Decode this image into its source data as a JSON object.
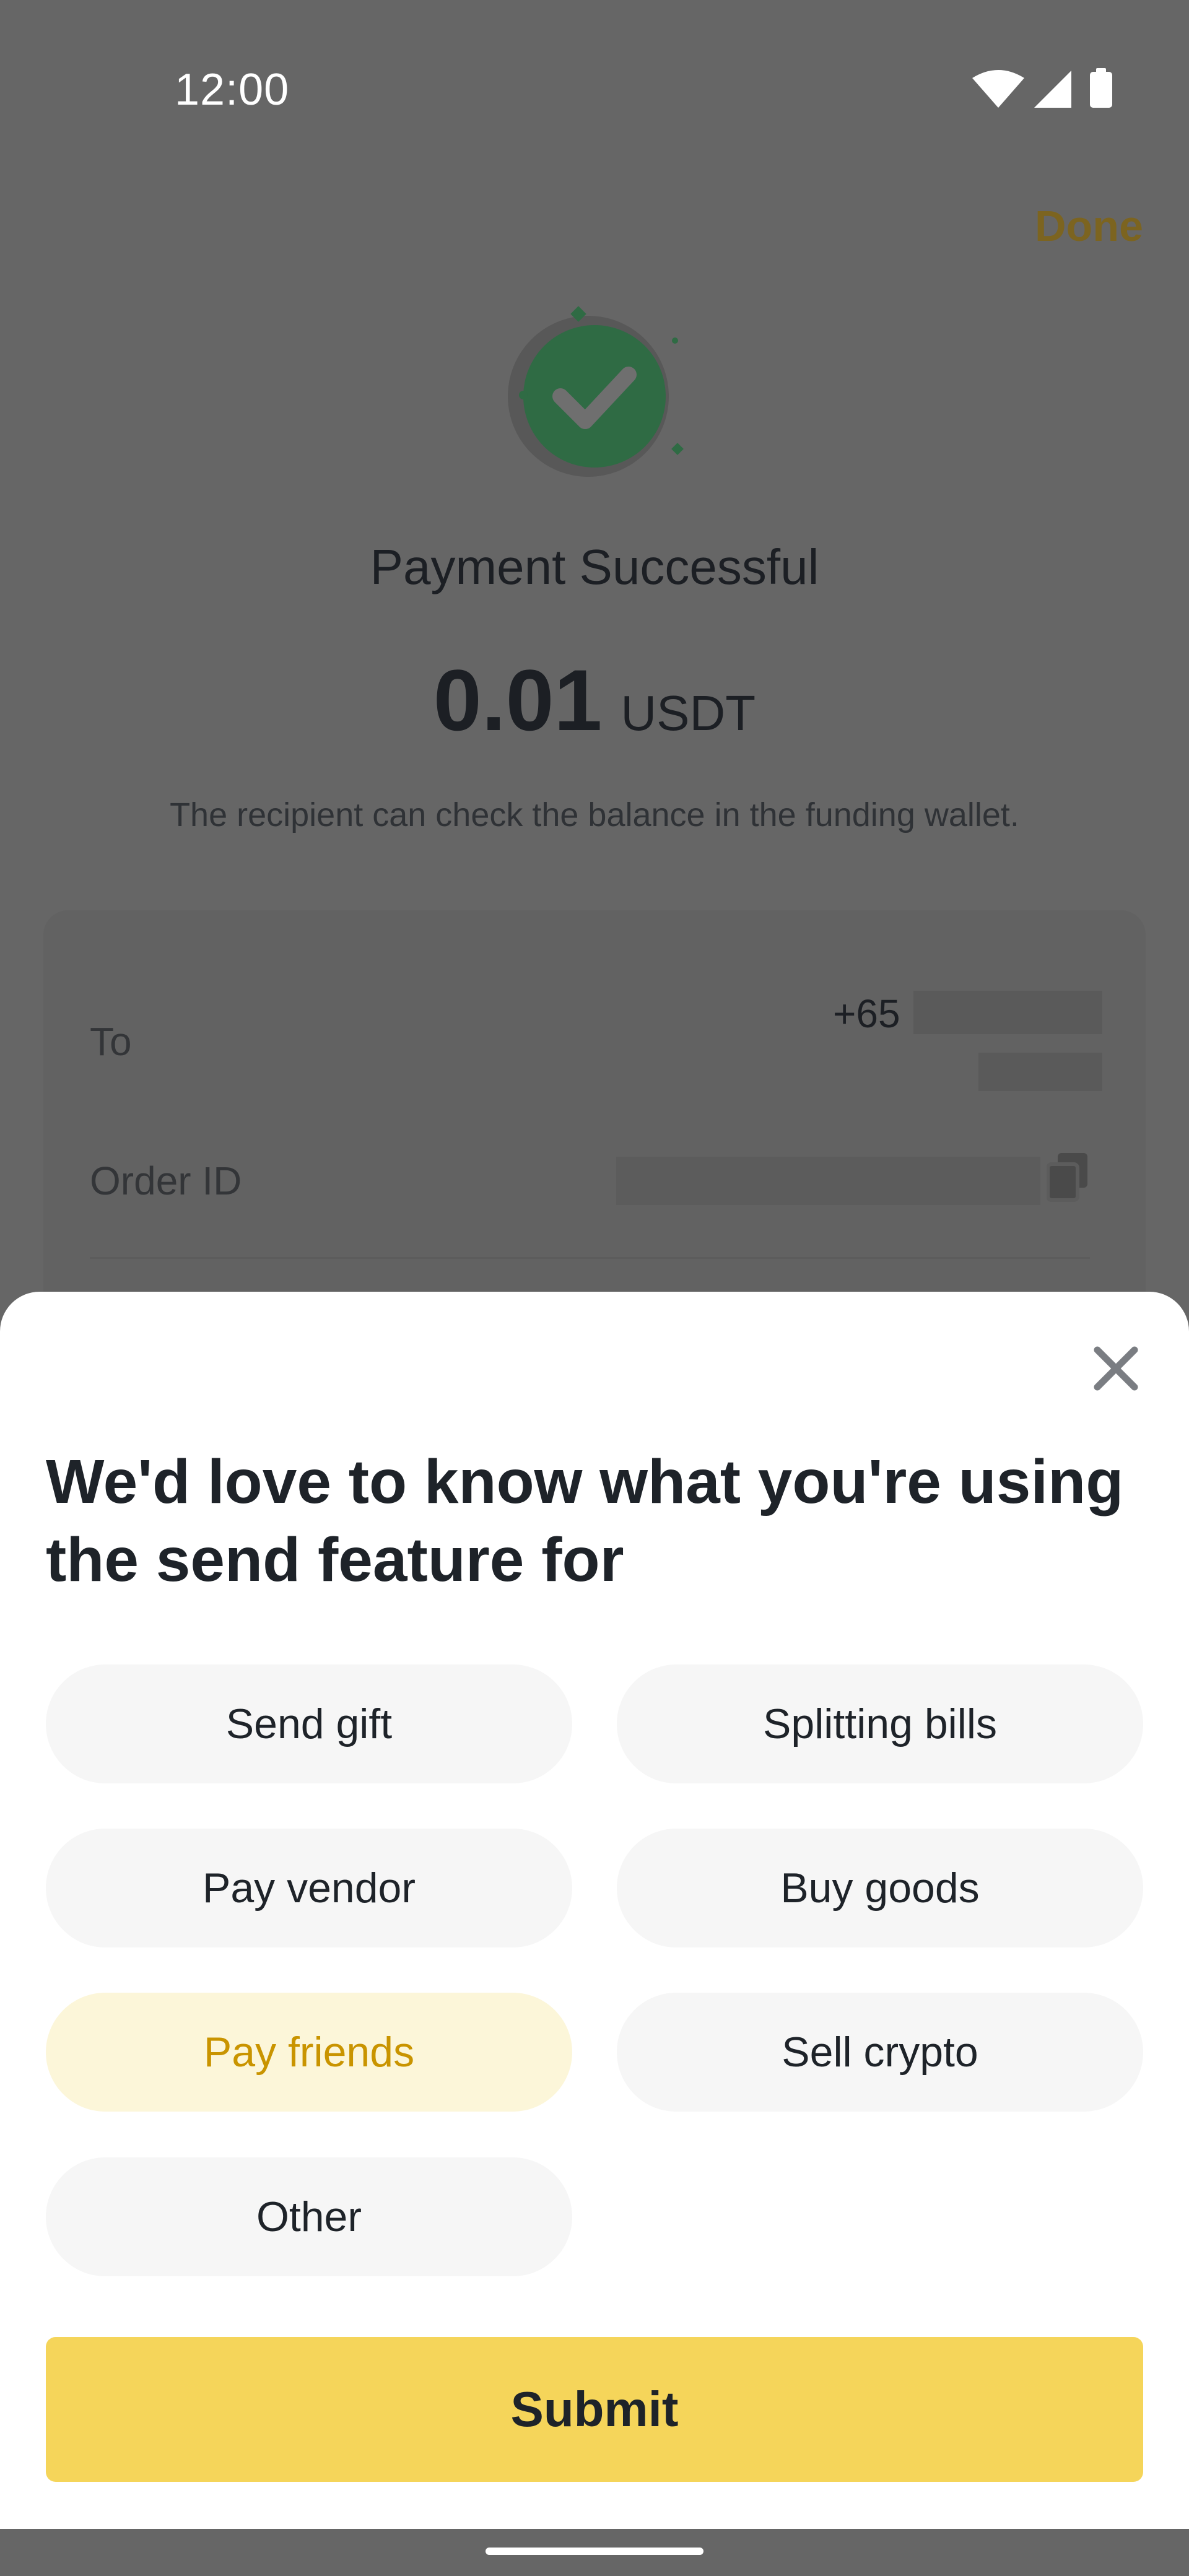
{
  "status_bar": {
    "time": "12:00",
    "icons": [
      "wifi-icon",
      "signal-icon",
      "battery-icon"
    ]
  },
  "payment": {
    "done_label": "Done",
    "title": "Payment Successful",
    "amount": "0.01",
    "currency": "USDT",
    "note": "The recipient can check the balance in the funding wallet.",
    "details": {
      "to_label": "To",
      "to_prefix": "+65",
      "order_label": "Order ID"
    }
  },
  "survey": {
    "title": "We'd love to know what you're using the send feature for",
    "options": [
      {
        "label": "Send gift",
        "selected": false
      },
      {
        "label": "Splitting bills",
        "selected": false
      },
      {
        "label": "Pay vendor",
        "selected": false
      },
      {
        "label": "Buy goods",
        "selected": false
      },
      {
        "label": "Pay friends",
        "selected": true
      },
      {
        "label": "Sell crypto",
        "selected": false
      },
      {
        "label": "Other",
        "selected": false
      }
    ],
    "submit_label": "Submit"
  },
  "colors": {
    "accent": "#F5D55A",
    "selected_text": "#C99400",
    "selected_bg": "#FCF6D9",
    "success": "#2E8B57",
    "overlay": "#666666"
  }
}
